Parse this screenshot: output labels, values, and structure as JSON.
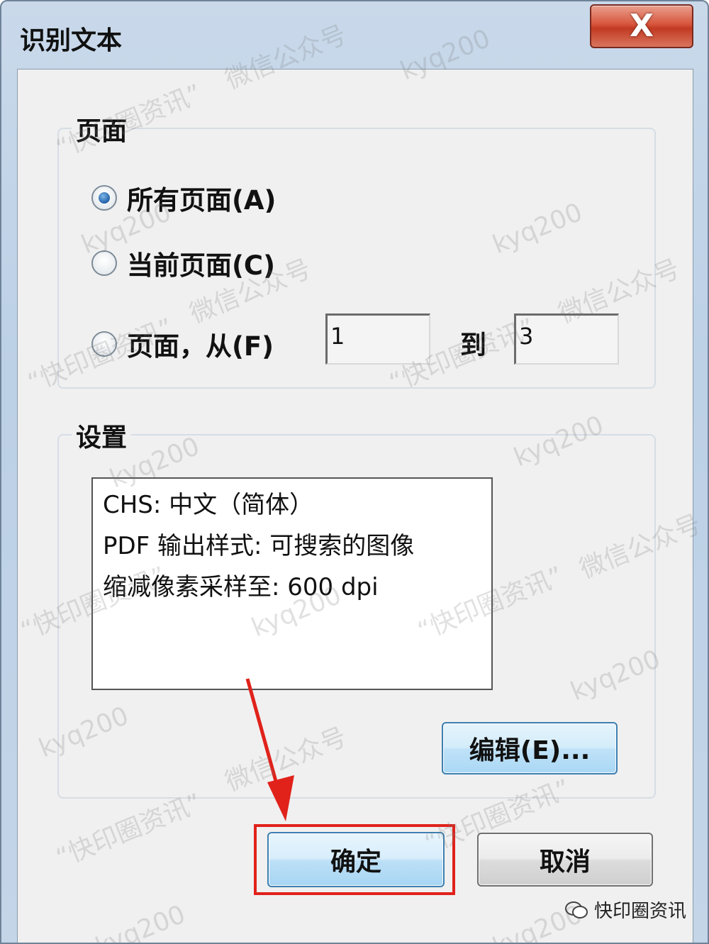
{
  "window": {
    "title": "识别文本"
  },
  "close_button": {
    "label": "X"
  },
  "pages_group": {
    "label": "页面",
    "radio_all": {
      "label": "所有页面(A)",
      "checked": true
    },
    "radio_current": {
      "label": "当前页面(C)",
      "checked": false
    },
    "radio_range": {
      "label": "页面，从(F)",
      "checked": false
    },
    "from_value": "1",
    "to_label": "到",
    "to_value": "3"
  },
  "settings_group": {
    "label": "设置",
    "lines": [
      "CHS: 中文（简体）",
      "PDF 输出样式: 可搜索的图像",
      "缩减像素采样至: 600 dpi"
    ],
    "edit_button": "编辑(E)..."
  },
  "buttons": {
    "ok": "确定",
    "cancel": "取消"
  },
  "watermarks": {
    "handle": "kyq200",
    "wechat": "微信公众号",
    "quote": "“快印圈资讯”"
  },
  "brand": {
    "text": "快印圈资讯"
  },
  "colors": {
    "highlight": "#e0221b",
    "accent": "#3c7fb1"
  }
}
